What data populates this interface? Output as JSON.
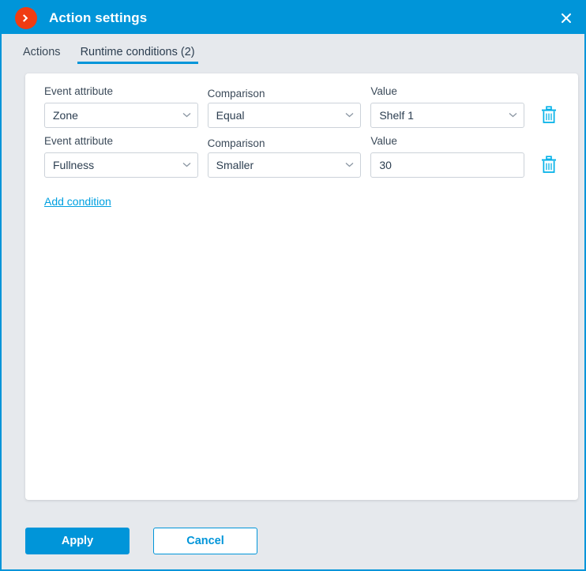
{
  "window": {
    "title": "Action settings",
    "title_icon": "chevron-right-circle-icon",
    "close_icon": "close-icon",
    "accent_color": "#0095d9",
    "icon_color": "#f03c12",
    "background_color": "#e6e9ed"
  },
  "tabs": [
    {
      "label": "Actions",
      "active": false
    },
    {
      "label": "Runtime conditions (2)",
      "active": true
    }
  ],
  "labels": {
    "event_attribute": "Event attribute",
    "comparison": "Comparison",
    "value": "Value"
  },
  "conditions": [
    {
      "attribute": {
        "value": "Zone",
        "type": "select"
      },
      "comparison": {
        "value": "Equal",
        "type": "select"
      },
      "value": {
        "value": "Shelf 1",
        "type": "select"
      },
      "delete_icon": "trash-icon"
    },
    {
      "attribute": {
        "value": "Fullness",
        "type": "select"
      },
      "comparison": {
        "value": "Smaller",
        "type": "select"
      },
      "value": {
        "value": "30",
        "type": "text"
      },
      "delete_icon": "trash-icon"
    }
  ],
  "add_condition": {
    "label": "Add condition",
    "color": "#00a0e0"
  },
  "footer": {
    "apply_label": "Apply",
    "cancel_label": "Cancel"
  }
}
